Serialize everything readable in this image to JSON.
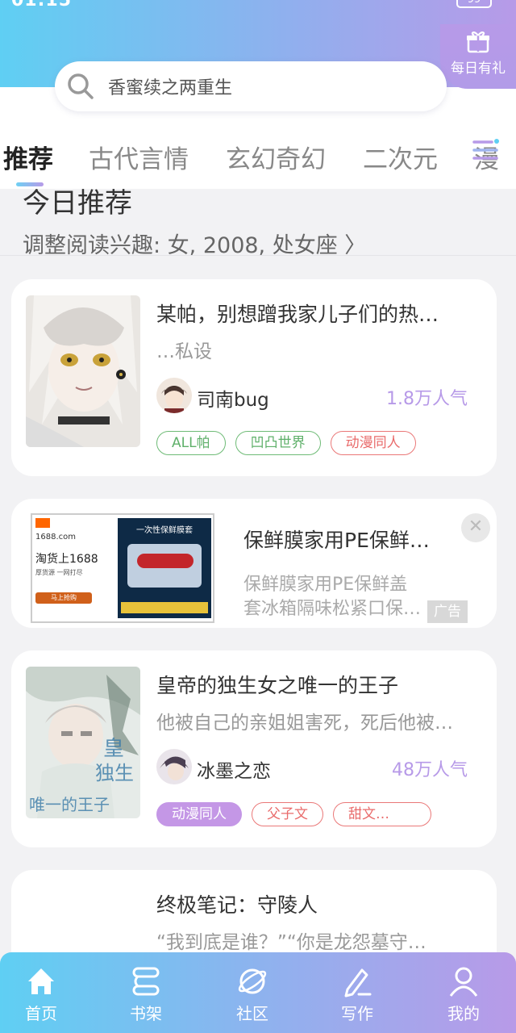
{
  "status": {
    "time": "01:15",
    "battery": "99"
  },
  "gift": {
    "label": "每日有礼"
  },
  "search": {
    "placeholder": "香蜜续之两重生"
  },
  "tabs": [
    {
      "label": "推荐",
      "active": true
    },
    {
      "label": "古代言情"
    },
    {
      "label": "玄幻奇幻"
    },
    {
      "label": "二次元"
    },
    {
      "label": "漫"
    }
  ],
  "today": {
    "title": "今日推荐",
    "subtitle": "调整阅读兴趣: 女, 2008, 处女座 〉"
  },
  "books": [
    {
      "title": "某帕，别想蹭我家儿子们的热…",
      "desc": "…私设",
      "author": "司南bug",
      "popularity": "1.8万人气",
      "tags": [
        {
          "label": "ALL帕",
          "style": "green"
        },
        {
          "label": "凹凸世界",
          "style": "green"
        },
        {
          "label": "动漫同人",
          "style": "red"
        }
      ]
    },
    {
      "title": "皇帝的独生女之唯一的王子",
      "desc": "他被自己的亲姐姐害死，死后他被…",
      "author": "冰墨之恋",
      "popularity": "48万人气",
      "tags": [
        {
          "label": "动漫同人",
          "style": "purple-fill"
        },
        {
          "label": "父子文",
          "style": "red"
        },
        {
          "label": "甜文…",
          "style": "red"
        }
      ]
    },
    {
      "title": "终极笔记：守陵人",
      "desc": "“我到底是谁？”“你是龙怨墓守…"
    }
  ],
  "ad": {
    "title": "保鲜膜家用PE保鲜…",
    "desc_line1": "保鲜膜家用PE保鲜盖",
    "desc_line2": "套冰箱隔味松紧口保…",
    "badge": "广告",
    "close": "✕",
    "image_text_site": "1688.com",
    "image_text_main": "淘货上1688",
    "image_text_sub": "厚货源 一网打尽",
    "image_text_btn": "马上抢购",
    "image_text_product": "一次性保鲜膜套"
  },
  "bottom_nav": [
    {
      "label": "首页",
      "icon": "home-icon"
    },
    {
      "label": "书架",
      "icon": "bookshelf-icon"
    },
    {
      "label": "社区",
      "icon": "planet-icon"
    },
    {
      "label": "写作",
      "icon": "pen-icon"
    },
    {
      "label": "我的",
      "icon": "user-icon"
    }
  ]
}
